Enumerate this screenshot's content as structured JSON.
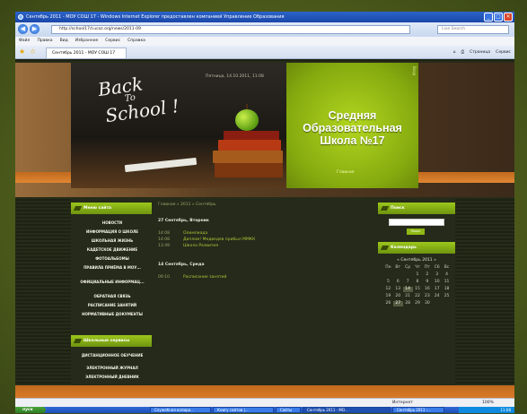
{
  "browser": {
    "title": "Сентябрь 2011 - МОУ СОШ 17 - Windows Internet Explorer предоставлен компанией Управление Образования",
    "address": "http://school17d.ucoz.org/news/2011-09",
    "search_placeholder": "Live Search",
    "menu": [
      "Файл",
      "Правка",
      "Вид",
      "Избранное",
      "Сервис",
      "Справка"
    ],
    "tab_title": "Сентябрь 2011 - МОУ СОШ 17",
    "tab_tools": [
      "Страница",
      "Сервис"
    ],
    "status_zone": "Интернет",
    "zoom": "100%"
  },
  "site": {
    "datetime": "Пятница, 14.10.2011, 11:08",
    "school_name": [
      "Средняя",
      "Образовательная",
      "Школа №17"
    ],
    "home_link": "Главная",
    "chalk": [
      "Back",
      "To",
      "School !"
    ]
  },
  "menu_block": {
    "title": "Меню сайта",
    "items": [
      "НОВОСТИ",
      "ИНФОРМАЦИЯ О ШКОЛЕ",
      "ШКОЛЬНАЯ ЖИЗНЬ",
      "КАДЕТСКОЕ ДВИЖЕНИЕ",
      "ФОТОАЛЬБОМЫ",
      "ПРАВИЛА ПРИЁМА В МОУ...",
      "ОФИЦИАЛЬНЫЕ ИНФОРМАЦ...",
      "ОБРАТНАЯ СВЯЗЬ",
      "РАСПИСАНИЕ ЗАНЯТИЙ",
      "НОРМАТИВНЫЕ ДОКУМЕНТЫ"
    ]
  },
  "services_block": {
    "title": "Школьные сервисы",
    "items": [
      "ДИСТАНЦИОННОЕ ОБУЧЕНИЕ",
      "ЭЛЕКТРОННЫЙ ЖУРНАЛ",
      "ЭЛЕКТРОННЫЙ ДНЕВНИК"
    ]
  },
  "main": {
    "breadcrumb": "Главная » 2011 » Сентябрь",
    "days": [
      {
        "heading": "27 Сентябрь, Вторник",
        "events": [
          {
            "time": "14:08",
            "title": "Олимпиада"
          },
          {
            "time": "14:08",
            "title": "Диплом! Медведев прибыл ММКК"
          },
          {
            "time": "13:49",
            "title": "Школа Развития"
          }
        ]
      },
      {
        "heading": "14 Сентябрь, Среда",
        "events": [
          {
            "time": "09:10",
            "title": "Расписание занятий"
          }
        ]
      }
    ]
  },
  "search_block": {
    "title": "Поиск",
    "button": "Поиск"
  },
  "calendar": {
    "title": "Календарь",
    "month": "« Сентябрь 2011 »",
    "weekdays": [
      "Пн",
      "Вт",
      "Ср",
      "Чт",
      "Пт",
      "Сб",
      "Вс"
    ],
    "rows": [
      [
        "",
        "",
        "",
        "1",
        "2",
        "3",
        "4"
      ],
      [
        "5",
        "6",
        "7",
        "8",
        "9",
        "10",
        "11"
      ],
      [
        "12",
        "13",
        "14",
        "15",
        "16",
        "17",
        "18"
      ],
      [
        "19",
        "20",
        "21",
        "22",
        "23",
        "24",
        "25"
      ],
      [
        "26",
        "27",
        "28",
        "29",
        "30",
        "",
        ""
      ]
    ],
    "highlighted": [
      "14",
      "27"
    ]
  },
  "taskbar": {
    "start": "пуск",
    "tasks": [
      "Служебная копира...",
      "Книгу сайтов |...",
      "Сайты",
      "Сентябрь 2011 - МО...",
      "Сентябрь 2011 -..."
    ],
    "active_task": 3,
    "clock": "11:08"
  },
  "colors": {
    "accent_green": "#9cc71b",
    "accent_orange": "#d77a28",
    "background_dark": "#252a1a"
  }
}
